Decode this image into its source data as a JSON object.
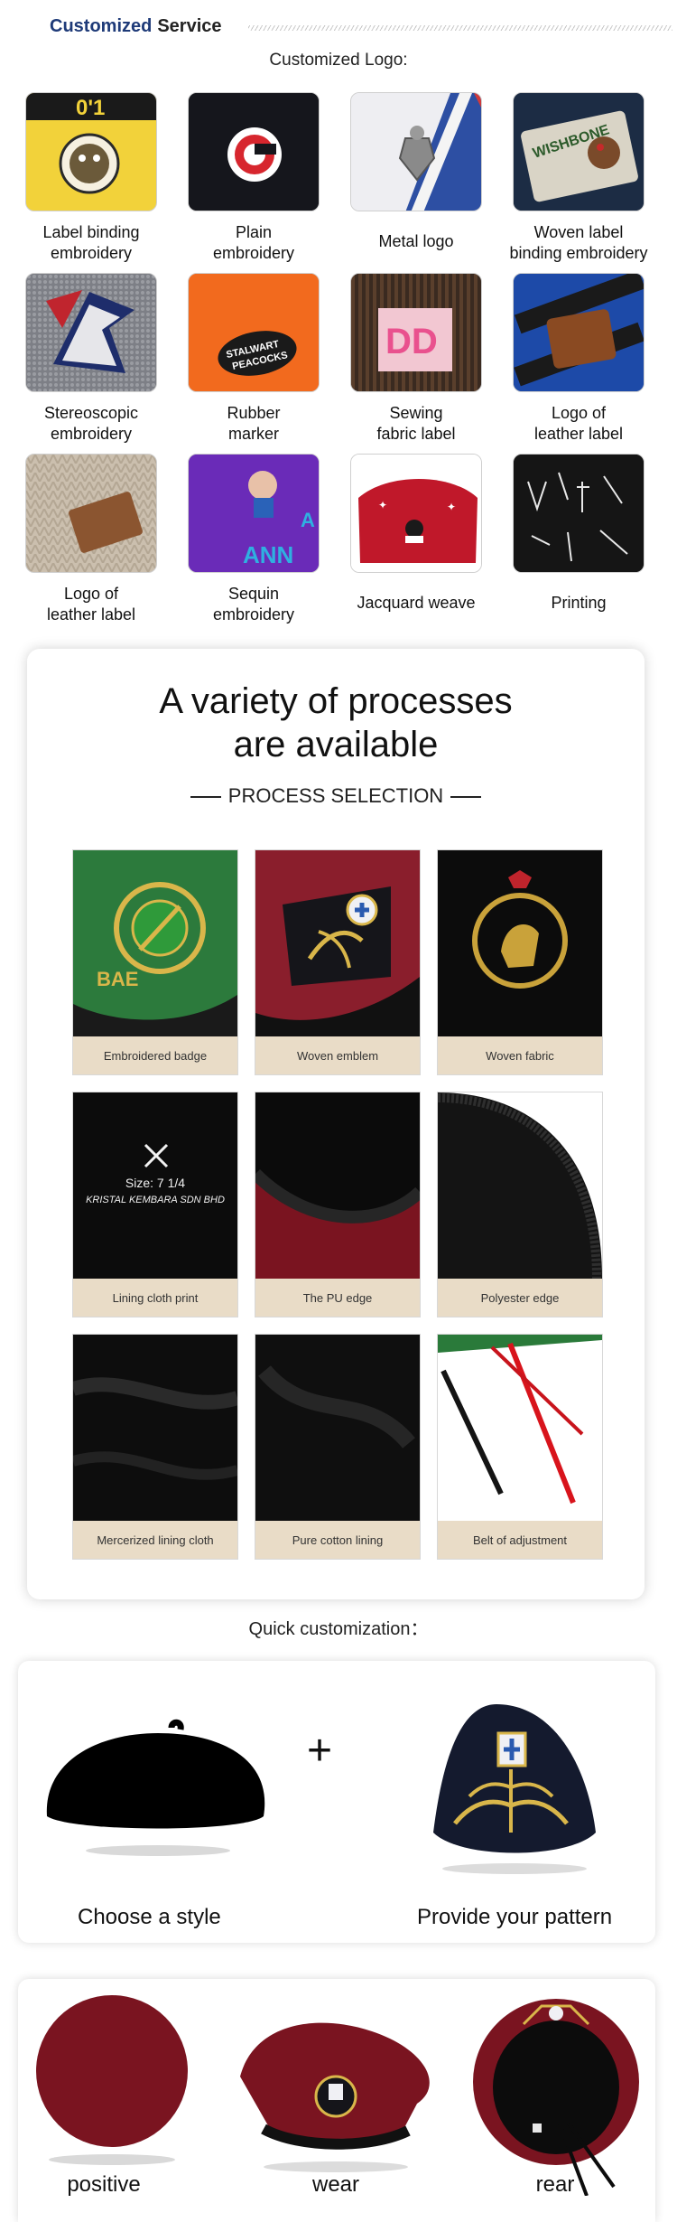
{
  "header": {
    "title_primary": "Customized",
    "title_secondary": "Service"
  },
  "customized_logo": {
    "title": "Customized Logo:",
    "items": [
      {
        "label": "Label binding\nembroidery",
        "icon": "yellow-knit-embroidered-patch"
      },
      {
        "label": "Plain\nembroidery",
        "icon": "black-beanie-plain-embroidery"
      },
      {
        "label": "Metal logo",
        "icon": "metal-badge-on-striped-knit"
      },
      {
        "label": "Woven label\nbinding embroidery",
        "icon": "woven-patch-turkey"
      },
      {
        "label": "Stereoscopic\nembroidery",
        "icon": "3d-embroidered-logo"
      },
      {
        "label": "Rubber\nmarker",
        "icon": "rubber-patch-orange"
      },
      {
        "label": "Sewing\nfabric label",
        "icon": "pink-fabric-label"
      },
      {
        "label": "Logo of\nleather label",
        "icon": "leather-patch-blue-stripes"
      },
      {
        "label": "Logo of\nleather label",
        "icon": "leather-patch-beige-knit"
      },
      {
        "label": "Sequin\nembroidery",
        "icon": "sequin-purple-beanie"
      },
      {
        "label": "Jacquard weave",
        "icon": "red-jacquard-knit"
      },
      {
        "label": "Printing",
        "icon": "black-printed-beanie"
      }
    ]
  },
  "process": {
    "heading_line1": "A variety of processes",
    "heading_line2": "are available",
    "subheading": "PROCESS SELECTION",
    "items": [
      {
        "label": "Embroidered badge",
        "icon": "green-beret-embroidered-badge"
      },
      {
        "label": "Woven emblem",
        "icon": "maroon-beret-woven-emblem"
      },
      {
        "label": "Woven fabric",
        "icon": "black-beret-lion-crest"
      },
      {
        "label": "Lining cloth print",
        "icon": "lining-print",
        "print_line1": "Size: 7 1/4",
        "print_line2": "KRISTAL KEMBARA SDN BHD"
      },
      {
        "label": "The PU edge",
        "icon": "pu-edge"
      },
      {
        "label": "Polyester edge",
        "icon": "polyester-edge"
      },
      {
        "label": "Mercerized lining cloth",
        "icon": "mercerized-lining"
      },
      {
        "label": "Pure cotton lining",
        "icon": "cotton-lining"
      },
      {
        "label": "Belt of adjustment",
        "icon": "adjustment-belt"
      }
    ]
  },
  "quick": {
    "title": "Quick customization：",
    "step1": "Choose a style",
    "plus": "+",
    "step2": "Provide your pattern"
  },
  "views": {
    "positive": "positive",
    "wear": "wear",
    "rear": "rear"
  },
  "colors": {
    "brand_blue": "#1e3a78",
    "label_bg": "#e9dcc7",
    "maroon": "#7a1420"
  }
}
